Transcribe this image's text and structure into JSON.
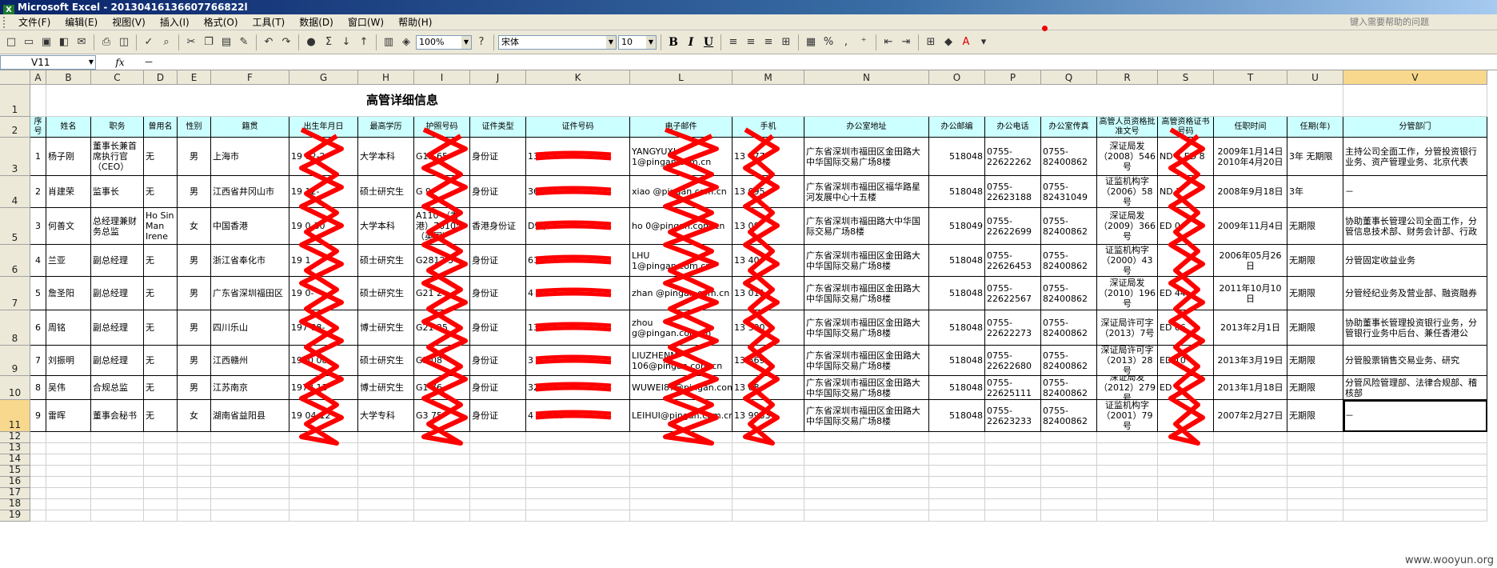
{
  "window": {
    "title": "Microsoft Excel - 20130416136607766822l",
    "logo": "X"
  },
  "menu": {
    "items": [
      "文件(F)",
      "编辑(E)",
      "视图(V)",
      "插入(I)",
      "格式(O)",
      "工具(T)",
      "数据(D)",
      "窗口(W)",
      "帮助(H)"
    ],
    "help_search_placeholder": "键入需要帮助的问题"
  },
  "toolbar": {
    "zoom": "100%",
    "font_name": "宋体",
    "font_size": "10",
    "bold": "B",
    "italic": "I",
    "underline": "U",
    "sigma": "Σ",
    "percent": "%",
    "comma": ","
  },
  "formula_bar": {
    "name_box": "V11",
    "fx": "fx",
    "content": "－"
  },
  "columns": [
    "A",
    "B",
    "C",
    "D",
    "E",
    "F",
    "G",
    "H",
    "I",
    "J",
    "K",
    "L",
    "M",
    "N",
    "O",
    "P",
    "Q",
    "R",
    "S",
    "T",
    "U",
    "V"
  ],
  "selected_column": "V",
  "selected_row": "11",
  "rows": [
    "1",
    "2",
    "3",
    "4",
    "5",
    "6",
    "7",
    "8",
    "9",
    "10",
    "11",
    "12",
    "13",
    "14",
    "15",
    "16",
    "17",
    "18",
    "19"
  ],
  "sheet": {
    "title": "高管详细信息",
    "headers": [
      "序号",
      "姓名",
      "职务",
      "曾用名",
      "性别",
      "籍贯",
      "出生年月日",
      "最高学历",
      "护照号码",
      "证件类型",
      "证件号码",
      "电子邮件",
      "手机",
      "办公室地址",
      "办公邮编",
      "办公电话",
      "办公室传真",
      "高管人员资格批准文号",
      "高管资格证书号码",
      "任职时间",
      "任期(年)",
      "分管部门"
    ],
    "records": [
      [
        "1",
        "杨子刚",
        "董事长兼首席执行官（CEO）",
        "无",
        "男",
        "上海市",
        "19  02-2",
        "大学本科",
        "G13    65",
        "身份证",
        "13     4",
        "YANGYUXI    1@pingan.com.cn",
        "13      477",
        "广东省深圳市福田区金田路大中华国际交易广场8楼",
        "518048",
        "0755-22622262",
        "0755-82400862",
        "深证局发（2008）546号",
        "ND       7 ED      8",
        "2009年1月14日 2010年4月20日",
        "3年 无期限",
        "主持公司全面工作，分管投资银行业务、资产管理业务、北京代表"
      ],
      [
        "2",
        "肖建荣",
        "监事长",
        "无",
        "男",
        "江西省井冈山市",
        "19  12-",
        "硕士研究生",
        "G     9",
        "身份证",
        "36      13",
        "xiao     @pingan.com.cn",
        "13     095",
        "广东省深圳市福田区福华路星河发展中心十五楼",
        "518048",
        "0755-22623188",
        "0755-82431049",
        "证监机构字（2006）58号",
        "ND      7",
        "2008年9月18日",
        "3年",
        "－"
      ],
      [
        "3",
        "何善文",
        "总经理兼财务总监",
        "Ho Sin Man Irene",
        "女",
        "中国香港",
        "19  0-30",
        "大学本科",
        "A110  （香港）76105  （英国）",
        "香港身份证",
        "D9     )",
        "ho    0@pingan.com.cn",
        "13     08",
        "广东省深圳市福田路大中华国际交易广场8楼",
        "518049",
        "0755-22622699",
        "0755-82400862",
        "深证局发（2009）366号",
        "ED      0",
        "2009年11月4日",
        "无期限",
        "协助董事长管理公司全面工作，分管信息技术部、财务会计部、行政"
      ],
      [
        "4",
        "兰亚",
        "副总经理",
        "无",
        "男",
        "浙江省奉化市",
        "19     1",
        "硕士研究生",
        "G2812   3",
        "身份证",
        "61     17",
        "LHU   1@pingan.com.cn",
        "13     40",
        "广东省深圳市福田区金田路大中华国际交易广场8楼",
        "518048",
        "0755-22626453",
        "0755-82400862",
        "证监机构字（2000）43号",
        "",
        "2006年05月26日",
        "无期限",
        "分管固定收益业务"
      ],
      [
        "5",
        "詹圣阳",
        "副总经理",
        "无",
        "男",
        "广东省深圳福田区",
        "19  0-",
        "硕士研究生",
        "G21   2",
        "身份证",
        "4     17",
        "zhan  @pingan.com.cn",
        "13  011",
        "广东省深圳市福田区金田路大中华国际交易广场8楼",
        "518048",
        "0755-22622567",
        "0755-82400862",
        "深证局发（2010）196号",
        "ED     44",
        "2011年10月10日",
        "无期限",
        "分管经纪业务及营业部、融资融券"
      ],
      [
        "6",
        "周铭",
        "副总经理",
        "无",
        "男",
        "四川乐山",
        "197  08-",
        "博士研究生",
        "G21   25",
        "身份证",
        "13     80",
        "zhou    g@pingan.com.cn",
        "13  300",
        "广东省深圳市福田区金田路大中华国际交易广场8楼",
        "518048",
        "0755-22622273",
        "0755-82400862",
        "深证局许可字（2013）7号",
        "ED     06",
        "2013年2月1日",
        "无期限",
        "协助董事长管理投资银行业务，分管银行业务中后台、兼任香港公"
      ],
      [
        "7",
        "刘振明",
        "副总经理",
        "无",
        "男",
        "江西赣州",
        "1970  08",
        "硕士研究生",
        "G5    08",
        "身份证",
        "3     4",
        "LIUZHENM  106@pingan.com.cn",
        "13     569",
        "广东省深圳市福田区金田路大中华国际交易广场8楼",
        "518048",
        "0755-22622680",
        "0755-82400862",
        "深证局许可字（2013）28号",
        "ED    10",
        "2013年3月19日",
        "无期限",
        "分管股票销售交易业务、研究"
      ],
      [
        "8",
        "吴伟",
        "合规总监",
        "无",
        "男",
        "江苏南京",
        "1973  13",
        "博士研究生",
        "G1    76",
        "身份证",
        "32     72",
        "WUWEI87@pingan.com.cn",
        "13     08",
        "广东省深圳市福田区金田路大中华国际交易广场8楼",
        "518048",
        "0755-22625111",
        "0755-82400862",
        "深证局发（2012）279号",
        "ED    4",
        "2013年1月18日",
        "无期限",
        "分管风险管理部、法律合规部、稽核部"
      ],
      [
        "9",
        "雷晖",
        "董事会秘书",
        "无",
        "女",
        "湖南省益阳县",
        "19  04-12",
        "大学专科",
        "G3    75",
        "身份证",
        "4     22520",
        "LEIHUI@pingan.com.cn",
        "13  9933",
        "广东省深圳市福田区金田路大中华国际交易广场8楼",
        "518048",
        "0755-22623233",
        "0755-82400862",
        "证监机构字（2001）79号",
        "",
        "2007年2月27日",
        "无期限",
        "－"
      ]
    ]
  },
  "watermark": "www.wooyun.org",
  "colors": {
    "header_fill": "#ccffff",
    "selection": "#f8d88c",
    "redaction": "#ff0000"
  }
}
